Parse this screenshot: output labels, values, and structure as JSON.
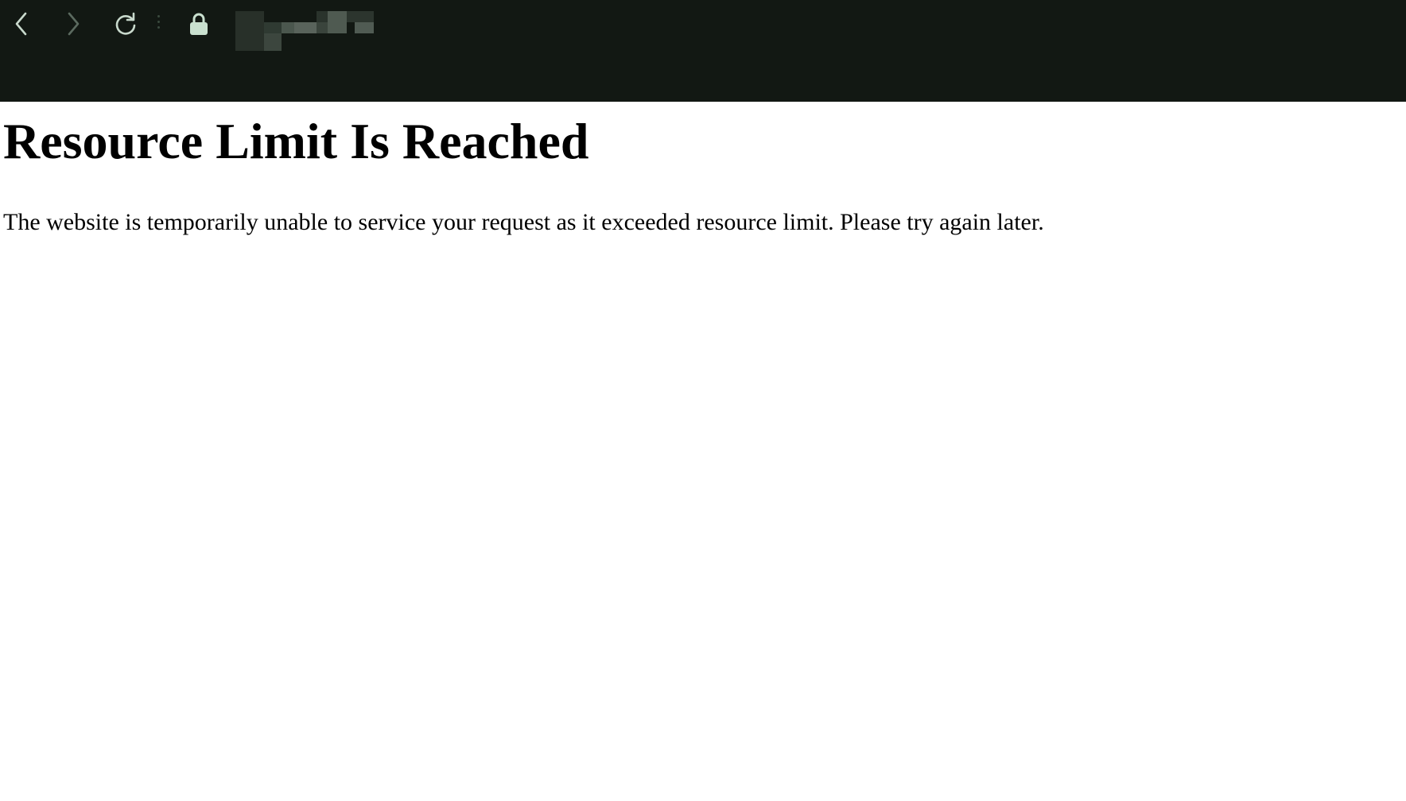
{
  "browser": {
    "toolbar_color": "#121813",
    "icon_color": "#c8d9cc",
    "disabled_icon_color": "#5b6a5f",
    "lock_color": "#c9e0cf",
    "icons": {
      "back": "chevron-left-icon",
      "forward": "chevron-right-icon",
      "reload": "reload-icon",
      "secure": "lock-icon"
    }
  },
  "page": {
    "heading": "Resource Limit Is Reached",
    "message": "The website is temporarily unable to service your request as it exceeded resource limit. Please try again later."
  }
}
